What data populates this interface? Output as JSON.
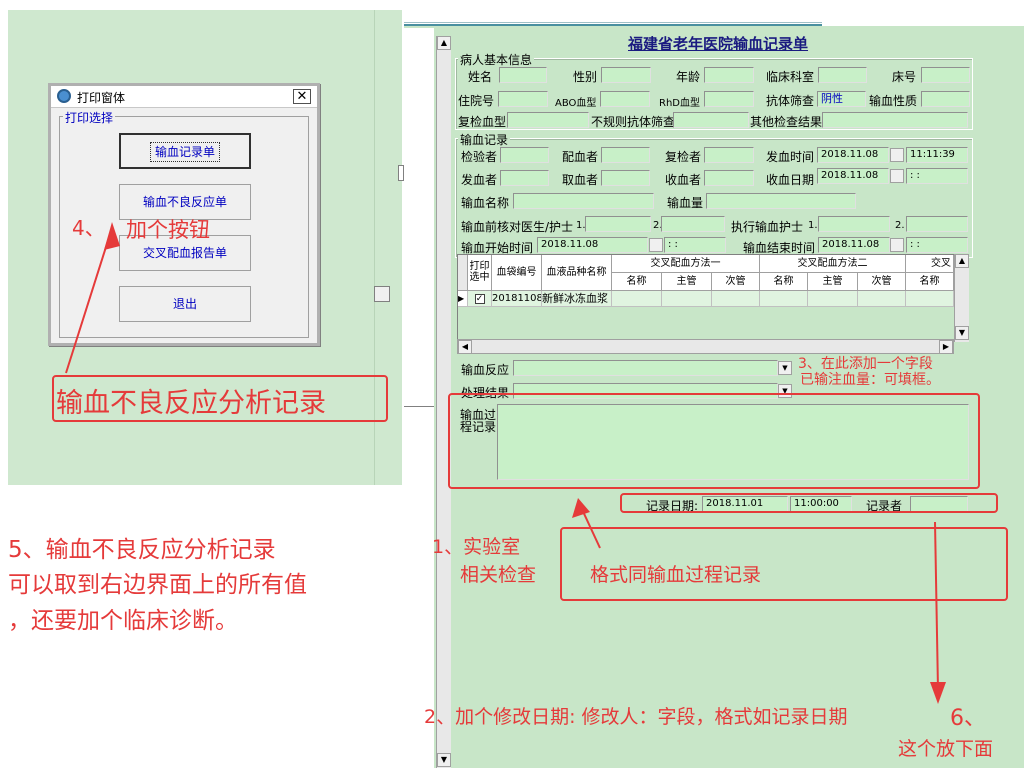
{
  "dialog": {
    "title": "打印窗体",
    "group_label": "打印选择",
    "buttons": [
      "输血记录单",
      "输血不良反应单",
      "交叉配血报告单",
      "退出"
    ]
  },
  "form": {
    "title": "福建省老年医院输血记录单",
    "patient_group": "病人基本信息",
    "patient": {
      "name": "姓名",
      "sex": "性别",
      "age": "年龄",
      "dept": "临床科室",
      "bed": "床号",
      "inpatient_no": "住院号",
      "abo": "ABO血型",
      "rhd": "RhD血型",
      "antibody": "抗体筛查",
      "antibody_value": "阴性",
      "nature": "输血性质",
      "recheck": "复检血型",
      "irregular": "不规则抗体筛查",
      "other": "其他检查结果"
    },
    "transfusion_group": "输血记录",
    "trans": {
      "inspector": "检验者",
      "matcher": "配血者",
      "rechecker": "复检者",
      "send_time": "发血时间",
      "send_date": "2018.11.08",
      "send_clock": "11:11:39",
      "sender": "发血者",
      "taker": "取血者",
      "receiver": "收血者",
      "receive_date_lbl": "收血日期",
      "receive_date": "2018.11.08",
      "receive_clock": "  :  :",
      "blood_name": "输血名称",
      "amount": "输血量",
      "pre_check": "输血前核对医生/护士",
      "n1": "1.",
      "n2": "2.",
      "exec_nurse": "执行输血护士",
      "e1": "1.",
      "e2": "2.",
      "start_time": "输血开始时间",
      "start_date": "2018.11.08",
      "start_clock": "  :  :",
      "end_time": "输血结束时间",
      "end_date": "2018.11.08",
      "end_clock": "  :  :"
    },
    "table": {
      "headers": [
        "打印选中",
        "血袋编号",
        "血液品种名称",
        "交叉配血方法一",
        "交叉配血方法二",
        "交叉"
      ],
      "subheaders": [
        "名称",
        "主管",
        "次管",
        "名称",
        "主管",
        "次管",
        "名称"
      ],
      "row": {
        "bag": "20181108(",
        "product": "新鲜冰冻血浆"
      }
    },
    "reaction": "输血反应",
    "handling": "处理结果",
    "process": "输血过程记录",
    "record_date_lbl": "记录日期:",
    "record_date": "2018.11.01",
    "record_clock": "11:00:00",
    "recorder": "记录者"
  },
  "annotations": {
    "a4": "4、",
    "a4b": "加个按钮",
    "big": "输血不良反应分析记录",
    "a5": [
      "5、输血不良反应分析记录",
      "可以取到右边界面上的所有值",
      "，还要加个临床诊断。"
    ],
    "a3": [
      "3、在此添加一个字段",
      "已输注血量：可填框。"
    ],
    "a1": [
      "1、实验室",
      "相关检查"
    ],
    "fmt": "格式同输血过程记录",
    "a2": "2、加个修改日期:      修改人：字段，格式如记录日期",
    "a6": [
      "6、",
      "这个放下面"
    ]
  },
  "colors": {
    "annotation": "#e53a3a",
    "form_bg": "#c8e6c8",
    "panel_bg": "#cfe8cf"
  }
}
